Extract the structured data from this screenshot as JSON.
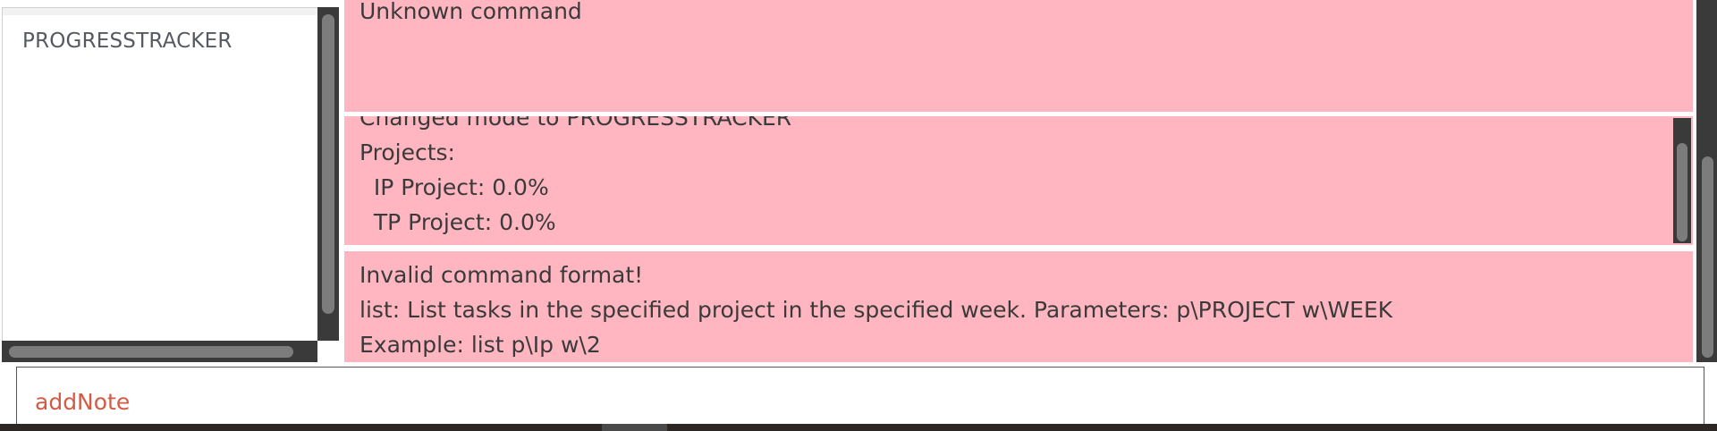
{
  "sidebar": {
    "items": [
      {
        "label": "PROGRESSTRACKER"
      }
    ]
  },
  "result_panels": [
    {
      "lines": [
        "Unknown command"
      ]
    },
    {
      "lines": [
        "Changed mode to PROGRESSTRACKER",
        "Projects:",
        "  IP Project: 0.0%",
        "  TP Project: 0.0%"
      ]
    },
    {
      "lines": [
        "Invalid command format!",
        "list: List tasks in the specified project in the specified week. Parameters: p\\PROJECT w\\WEEK",
        "Example: list p\\Ip w\\2"
      ]
    }
  ],
  "command_box": {
    "value": "addNote"
  },
  "colors": {
    "panel_bg": "#ffb6c1",
    "command_text": "#d35b45",
    "scrollbar_track": "#3a3a3a",
    "scrollbar_thumb": "#7c7c7c"
  }
}
